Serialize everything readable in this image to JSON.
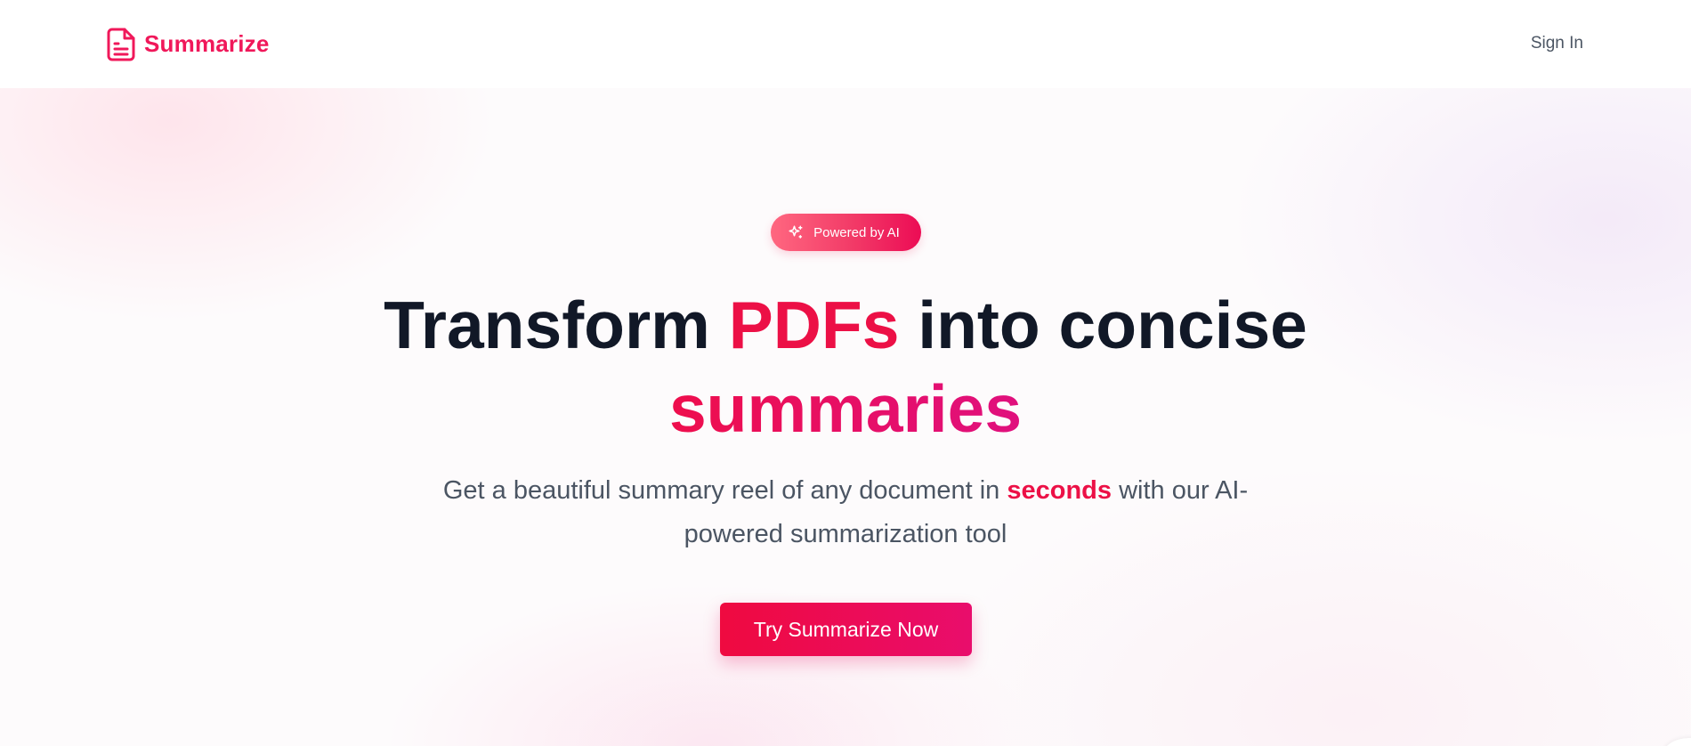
{
  "navbar": {
    "brand_name": "Summarize",
    "brand_icon": "file-text-icon",
    "sign_in_label": "Sign In"
  },
  "hero": {
    "badge": {
      "icon": "sparkles-icon",
      "label": "Powered by AI"
    },
    "headline": {
      "part1": "Transform ",
      "accent": "PDFs",
      "part2": " into concise",
      "accent2": "summaries"
    },
    "subtitle": {
      "part1": "Get a beautiful summary reel of any document in ",
      "emphasis": "seconds",
      "part2": " with our AI-powered summarization tool"
    },
    "cta_label": "Try Summarize Now"
  },
  "colors": {
    "brand": "#f0185a",
    "accent": "#ec1046",
    "accent_pink": "#e0107e",
    "heading": "#111827",
    "body_text": "#4b5563"
  }
}
